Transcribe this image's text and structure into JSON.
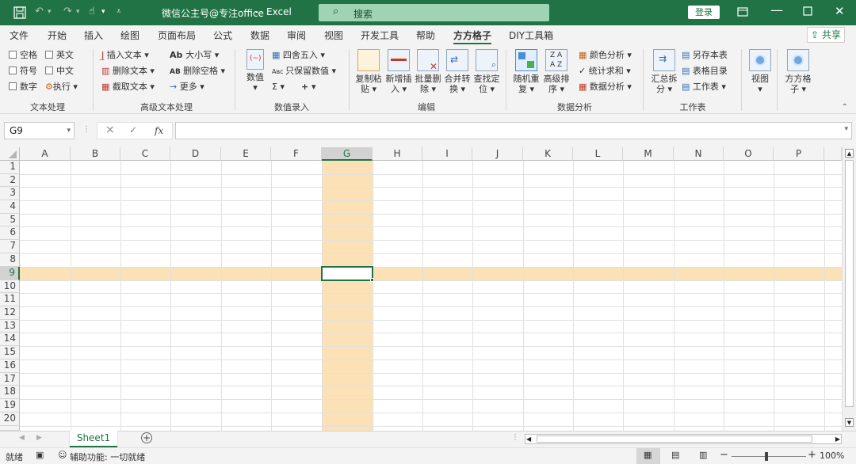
{
  "title_bar": {
    "file_title": "微信公主号@专注office",
    "separator": "-",
    "app_name": "Excel",
    "search_placeholder": "搜索",
    "login_label": "登录",
    "theme_color": "#217346"
  },
  "menu": {
    "tabs": [
      "文件",
      "开始",
      "插入",
      "绘图",
      "页面布局",
      "公式",
      "数据",
      "审阅",
      "视图",
      "开发工具",
      "帮助",
      "方方格子",
      "DIY工具箱"
    ],
    "active_tab": "方方格子",
    "share_label": "共享"
  },
  "ribbon": {
    "text_processing": {
      "checkboxes": [
        "空格",
        "英文",
        "符号",
        "中文",
        "数字"
      ],
      "exec_label": "执行",
      "group_label": "文本处理"
    },
    "advanced_text": {
      "items": [
        "插入文本",
        "大小写",
        "删除文本",
        "删除空格",
        "截取文本",
        "更多"
      ],
      "group_label": "高级文本处理"
    },
    "numeric_entry": {
      "big_label": "数值",
      "items": [
        "四舍五入",
        "只保留数值",
        "Σ",
        "+"
      ],
      "group_label": "数值录入"
    },
    "edit": {
      "buttons": [
        {
          "line1": "复制粘",
          "line2": "贴"
        },
        {
          "line1": "新增插",
          "line2": "入"
        },
        {
          "line1": "批量删",
          "line2": "除"
        },
        {
          "line1": "合并转",
          "line2": "换"
        },
        {
          "line1": "查找定",
          "line2": "位"
        }
      ],
      "group_label": "编辑"
    },
    "data_analysis": {
      "buttons": [
        {
          "line1": "随机重",
          "line2": "复"
        },
        {
          "line1": "高级排",
          "line2": "序"
        }
      ],
      "items": [
        "颜色分析",
        "统计求和",
        "数据分析"
      ],
      "group_label": "数据分析"
    },
    "worksheet": {
      "big": {
        "line1": "汇总拆",
        "line2": "分"
      },
      "items": [
        "另存本表",
        "表格目录",
        "工作表"
      ],
      "group_label": "工作表"
    },
    "view": {
      "label": "视图"
    },
    "ffgz": {
      "line1": "方方格",
      "line2": "子"
    }
  },
  "formula_bar": {
    "name_box": "G9",
    "cancel": "×",
    "confirm": "✓",
    "fx": "fx",
    "formula": ""
  },
  "sheet": {
    "columns": [
      "A",
      "B",
      "C",
      "D",
      "E",
      "F",
      "G",
      "H",
      "I",
      "J",
      "K",
      "L",
      "M",
      "N",
      "O",
      "P"
    ],
    "rows": [
      "1",
      "2",
      "3",
      "4",
      "5",
      "6",
      "7",
      "8",
      "9",
      "10",
      "11",
      "12",
      "13",
      "14",
      "15",
      "16",
      "17",
      "18",
      "19",
      "20"
    ],
    "selected_cell": "G9",
    "highlight_color": "#fbe1b5"
  },
  "tabs": {
    "sheet_name": "Sheet1"
  },
  "status_bar": {
    "ready": "就绪",
    "accessibility": "辅助功能: 一切就绪",
    "zoom": "100%"
  }
}
